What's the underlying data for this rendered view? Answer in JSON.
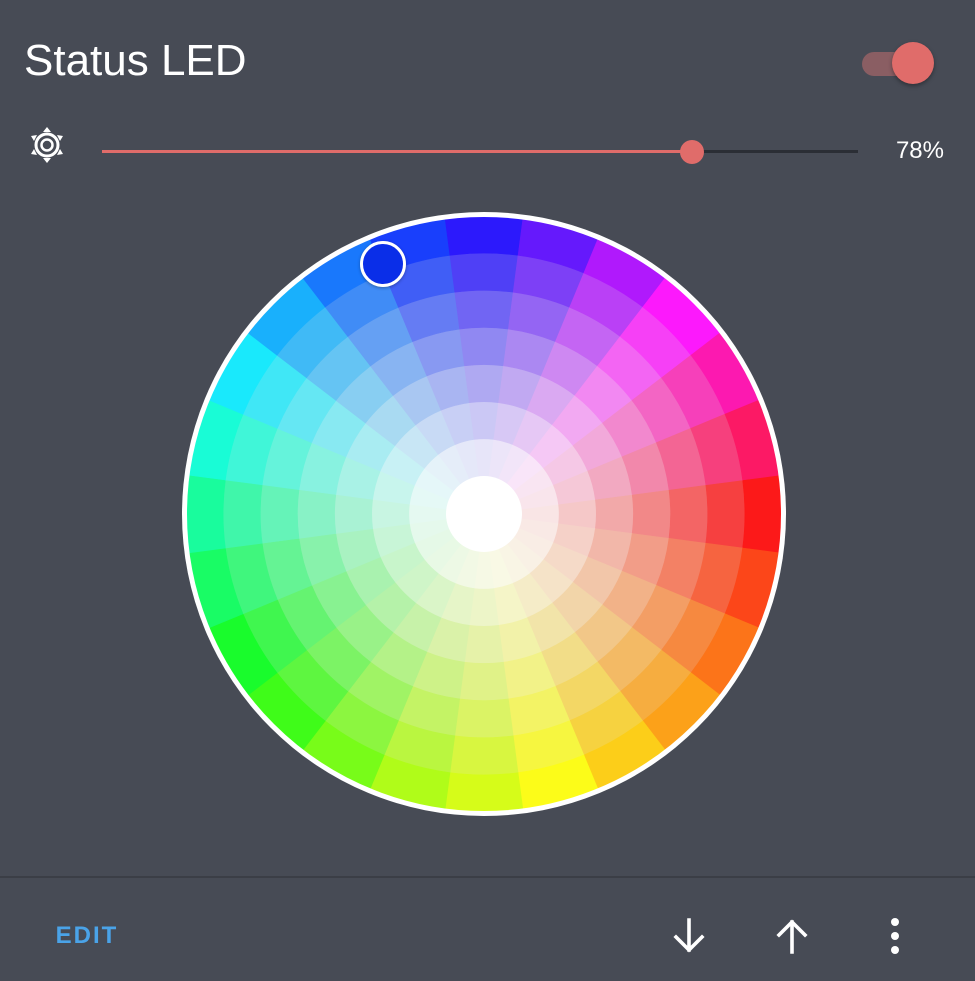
{
  "card": {
    "title": "Status LED",
    "toggle_on": true
  },
  "brightness": {
    "icon": "brightness-icon",
    "value": 78,
    "label": "78%"
  },
  "color_wheel": {
    "selected_color": "#0a2ee8"
  },
  "footer": {
    "edit_label": "EDIT",
    "icons": [
      "arrow-down-icon",
      "arrow-up-icon",
      "more-vert-icon"
    ]
  },
  "colors": {
    "background": "#474b55",
    "accent": "#e06c6a",
    "edit_text": "#4aa3e8"
  }
}
